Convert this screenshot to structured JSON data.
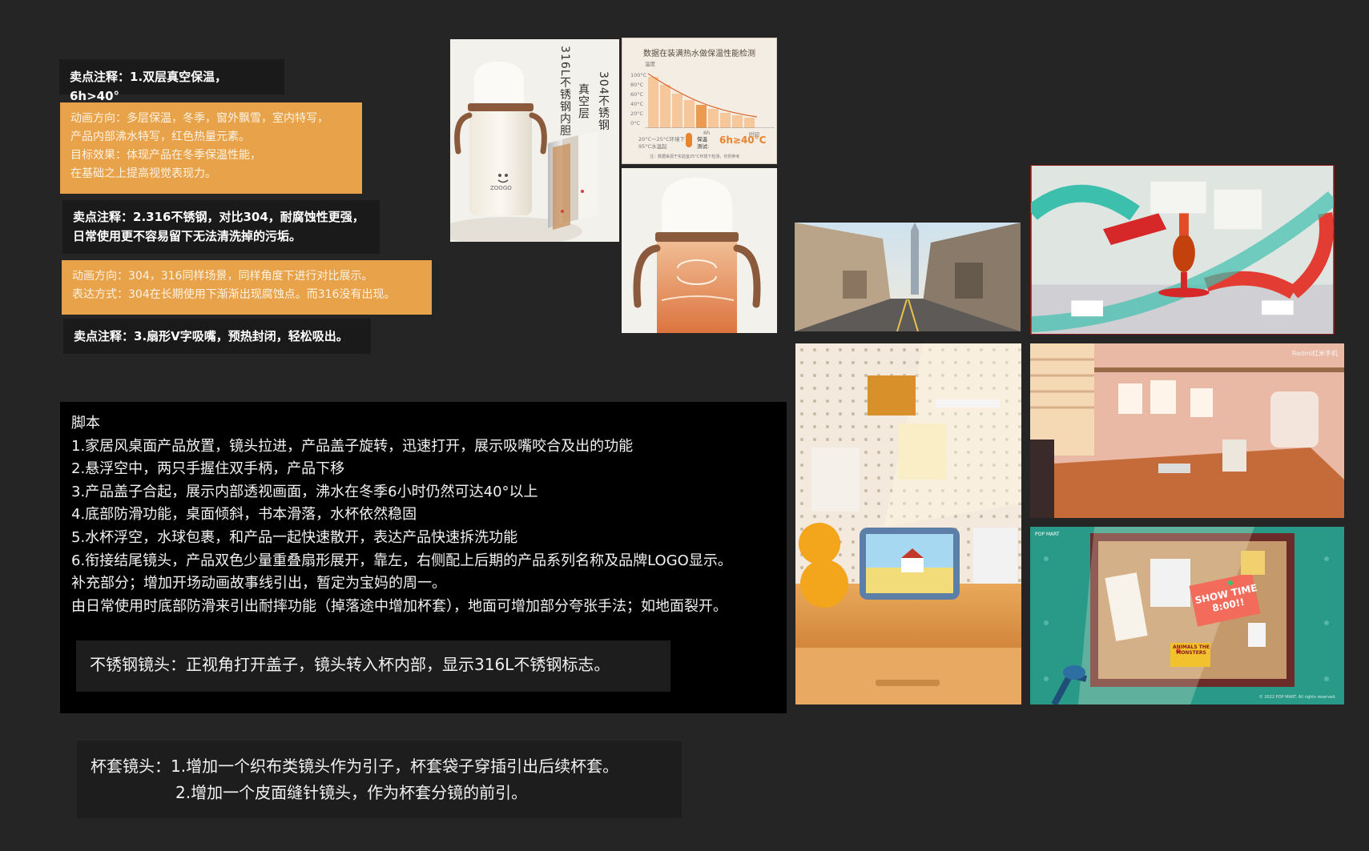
{
  "notes": {
    "note1": "卖点注释：1.双层真空保温，6h>40°",
    "anim1": [
      "动画方向：多层保温，冬季，窗外飘雪，室内特写，",
      "产品内部沸水特写，红色热量元素。",
      "目标效果：体现产品在冬季保温性能，",
      "在基础之上提高视觉表现力。"
    ],
    "note2": [
      "卖点注释：2.316不锈钢，对比304，耐腐蚀性更强，",
      "日常使用更不容易留下无法清洗掉的污垢。"
    ],
    "anim2": [
      "动画方向：304，316同样场景，同样角度下进行对比展示。",
      "表达方式：304在长期使用下渐渐出现腐蚀点。而316没有出现。"
    ],
    "note3": "卖点注释：3.扇形V字吸嘴，预热封闭，轻松吸出。"
  },
  "script": {
    "lines": [
      "脚本",
      "1.家居风桌面产品放置，镜头拉进，产品盖子旋转，迅速打开，展示吸嘴咬合及出的功能",
      "2.悬浮空中，两只手握住双手柄，产品下移",
      "3.产品盖子合起，展示内部透视画面，沸水在冬季6小时仍然可达40°以上",
      "4.底部防滑功能，桌面倾斜，书本滑落，水杯依然稳固",
      "5.水杯浮空，水球包裹，和产品一起快速散开，表达产品快速拆洗功能",
      "6.衔接结尾镜头，产品双色少量重叠扇形展开，靠左，右侧配上后期的产品系列名称及品牌LOGO显示。",
      "补充部分；增加开场动画故事线引出，暂定为宝妈的周一。",
      "由日常使用时底部防滑来引出耐摔功能（掉落途中增加杯套），地面可增加部分夸张手法；如地面裂开。"
    ],
    "steel_shot": "不锈钢镜头：正视角打开盖子，镜头转入杯内部，显示316L不锈钢标志。"
  },
  "cup_shot": {
    "line1": "杯套镜头：1.增加一个织布类镜头作为引子，杯套袋子穿插引出后续杯套。",
    "line2": "2.增加一个皮面缝针镜头，作为杯套分镜的前引。"
  },
  "product_image": {
    "label_316": "316L不锈钢内胆",
    "label_vacuum": "真空层",
    "label_304": "304不锈钢",
    "brand": "ZOOGO"
  },
  "thermal_chart": {
    "title": "数据在装满热水做保温性能检测",
    "unit": "温度",
    "ticks": [
      "100°C",
      "80°C",
      "60°C",
      "40°C",
      "20°C",
      "0°C"
    ],
    "x_mid": "6h",
    "x_end": "时间",
    "left_note_1": "20°C～25°C环境下",
    "left_note_2": "95°C水温起",
    "mid_label": "保温",
    "mid_label_2": "测试:",
    "result": "6h≥40°C",
    "footnote": "注：数据来源于实验室25°C环境下检测，仅供参考"
  },
  "scene_images": {
    "kids_room_tag": "Redmi红米手机",
    "board_note": "SHOW TIME 8:00!!",
    "board_sticker": "ANIMALS THE MONSTERS",
    "board_tag1": "POP MART",
    "board_copyright": "© 2022 POP MART. All rights reserved."
  },
  "colors": {
    "background": "#252525",
    "orange": "#e8a24a",
    "dark_note": "#1a1a1a",
    "script_bg": "#000000"
  }
}
